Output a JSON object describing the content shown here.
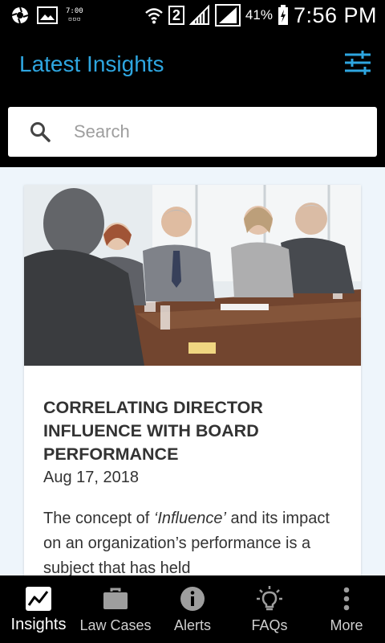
{
  "status_bar": {
    "mini_clock": "7:00",
    "sim_slot": "2",
    "battery_percent": "41%",
    "time": "7:56 PM"
  },
  "app_bar": {
    "title": "Latest Insights",
    "filter_icon": "sliders-icon",
    "accent_color": "#2ea6e0"
  },
  "search": {
    "placeholder": "Search",
    "value": ""
  },
  "articles": [
    {
      "title": "CORRELATING DIRECTOR INFLUENCE WITH BOARD PERFORMANCE",
      "date": "Aug 17, 2018",
      "excerpt_before": "The concept of ",
      "excerpt_em": "‘Influence’",
      "excerpt_after": " and its impact on an organization’s performance is a subject that has held"
    }
  ],
  "bottom_nav": {
    "items": [
      {
        "label": "Insights",
        "icon": "trend-chart-icon",
        "active": true
      },
      {
        "label": "Law Cases",
        "icon": "briefcase-icon",
        "active": false
      },
      {
        "label": "Alerts",
        "icon": "info-icon",
        "active": false
      },
      {
        "label": "FAQs",
        "icon": "lightbulb-icon",
        "active": false
      },
      {
        "label": "More",
        "icon": "more-vertical-icon",
        "active": false
      }
    ]
  }
}
